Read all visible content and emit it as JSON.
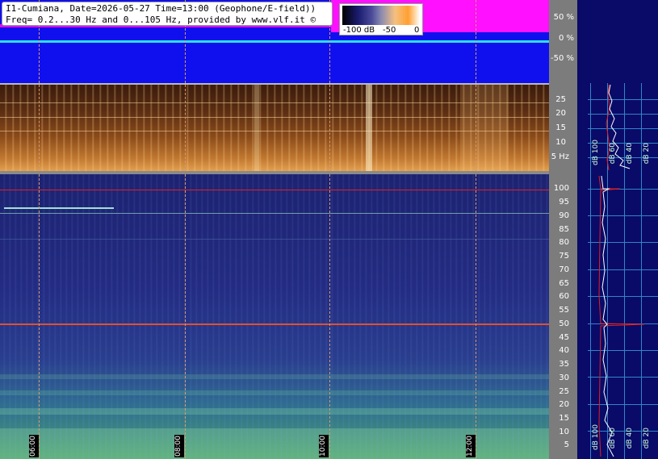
{
  "header": {
    "line1": "I1-Cumiana, Date=2026-05-27 Time=13:00 (Geophone/E-field))",
    "line2": "Freq= 0.2...30 Hz and 0...105 Hz, provided by www.vlf.it ©"
  },
  "color_scale": {
    "labels": [
      "-100 dB",
      "-50",
      "0"
    ]
  },
  "wave_axis": [
    "50 %",
    "0 %",
    "-50 %"
  ],
  "geophone_axis": [
    "25",
    "20",
    "15",
    "10",
    "5 Hz"
  ],
  "vlf_axis": [
    "100",
    "95",
    "90",
    "85",
    "80",
    "75",
    "70",
    "65",
    "60",
    "55",
    "50",
    "45",
    "40",
    "35",
    "30",
    "25",
    "20",
    "15",
    "10",
    "5"
  ],
  "time_labels": [
    "06:00",
    "08:00",
    "10:00",
    "12:00"
  ],
  "right_top_labels": [
    "dB 100",
    "dB 60",
    "dB 40",
    "dB 20"
  ],
  "right_bottom_labels": [
    "dB 100",
    "dB 60",
    "dB 40",
    "dB 20"
  ],
  "colors": {
    "wave_bg": "#1010ee",
    "magenta": "#ff10ff",
    "cyan": "#2be0e8",
    "red_line": "#e02020",
    "panel_bg": "#0a0a68",
    "grid": "#2f86c8"
  }
}
